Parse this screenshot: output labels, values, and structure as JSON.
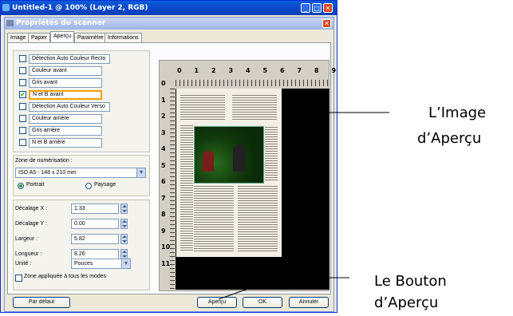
{
  "outer_window": {
    "title": "Untitled-1 @ 100% (Layer 2, RGB)"
  },
  "dialog": {
    "title": "Propriétés du scanner",
    "tabs": [
      "Image",
      "Papier",
      "Aperçu",
      "Paramètre",
      "Informations"
    ],
    "active_tab": "Aperçu",
    "image_options": [
      {
        "label": "Détection Auto Couleur Recto",
        "checked": false
      },
      {
        "label": "Couleur avant",
        "checked": false
      },
      {
        "label": "Gris avant",
        "checked": false
      },
      {
        "label": "N et B avant",
        "checked": true
      },
      {
        "label": "Détection Auto Couleur Verso",
        "checked": false
      },
      {
        "label": "Couleur arrière",
        "checked": false
      },
      {
        "label": "Gris arrière",
        "checked": false
      },
      {
        "label": "N et B arrière",
        "checked": false
      }
    ],
    "scan_zone": {
      "label": "Zone de numérisation :",
      "value": "ISO A5 - 148 x 210 mm",
      "portrait_label": "Portrait",
      "landscape_label": "Paysage",
      "orientation": "Portrait"
    },
    "offsets": {
      "x_label": "Décalage X :",
      "x_value": "1.33",
      "y_label": "Décalage Y :",
      "y_value": "0.00",
      "width_label": "Largeur :",
      "width_value": "5.82",
      "length_label": "Longueur :",
      "length_value": "8.26",
      "unit_label": "Unité :",
      "unit_value": "Pouces",
      "apply_all_label": "Zone appliquée à tous les modes"
    },
    "ruler": {
      "top": [
        "0",
        "1",
        "2",
        "3",
        "4",
        "5",
        "6",
        "7",
        "8",
        "9"
      ],
      "left": [
        "0",
        "1",
        "2",
        "3",
        "4",
        "5",
        "6",
        "7",
        "8",
        "9",
        "10",
        "11"
      ]
    },
    "buttons": {
      "default": "Par défaut",
      "preview": "Aperçu",
      "ok": "OK",
      "cancel": "Annuler"
    }
  },
  "callouts": {
    "preview_image": [
      "L’Image",
      "d’Aperçu"
    ],
    "preview_button": [
      "Le Bouton",
      "d’Aperçu"
    ]
  }
}
